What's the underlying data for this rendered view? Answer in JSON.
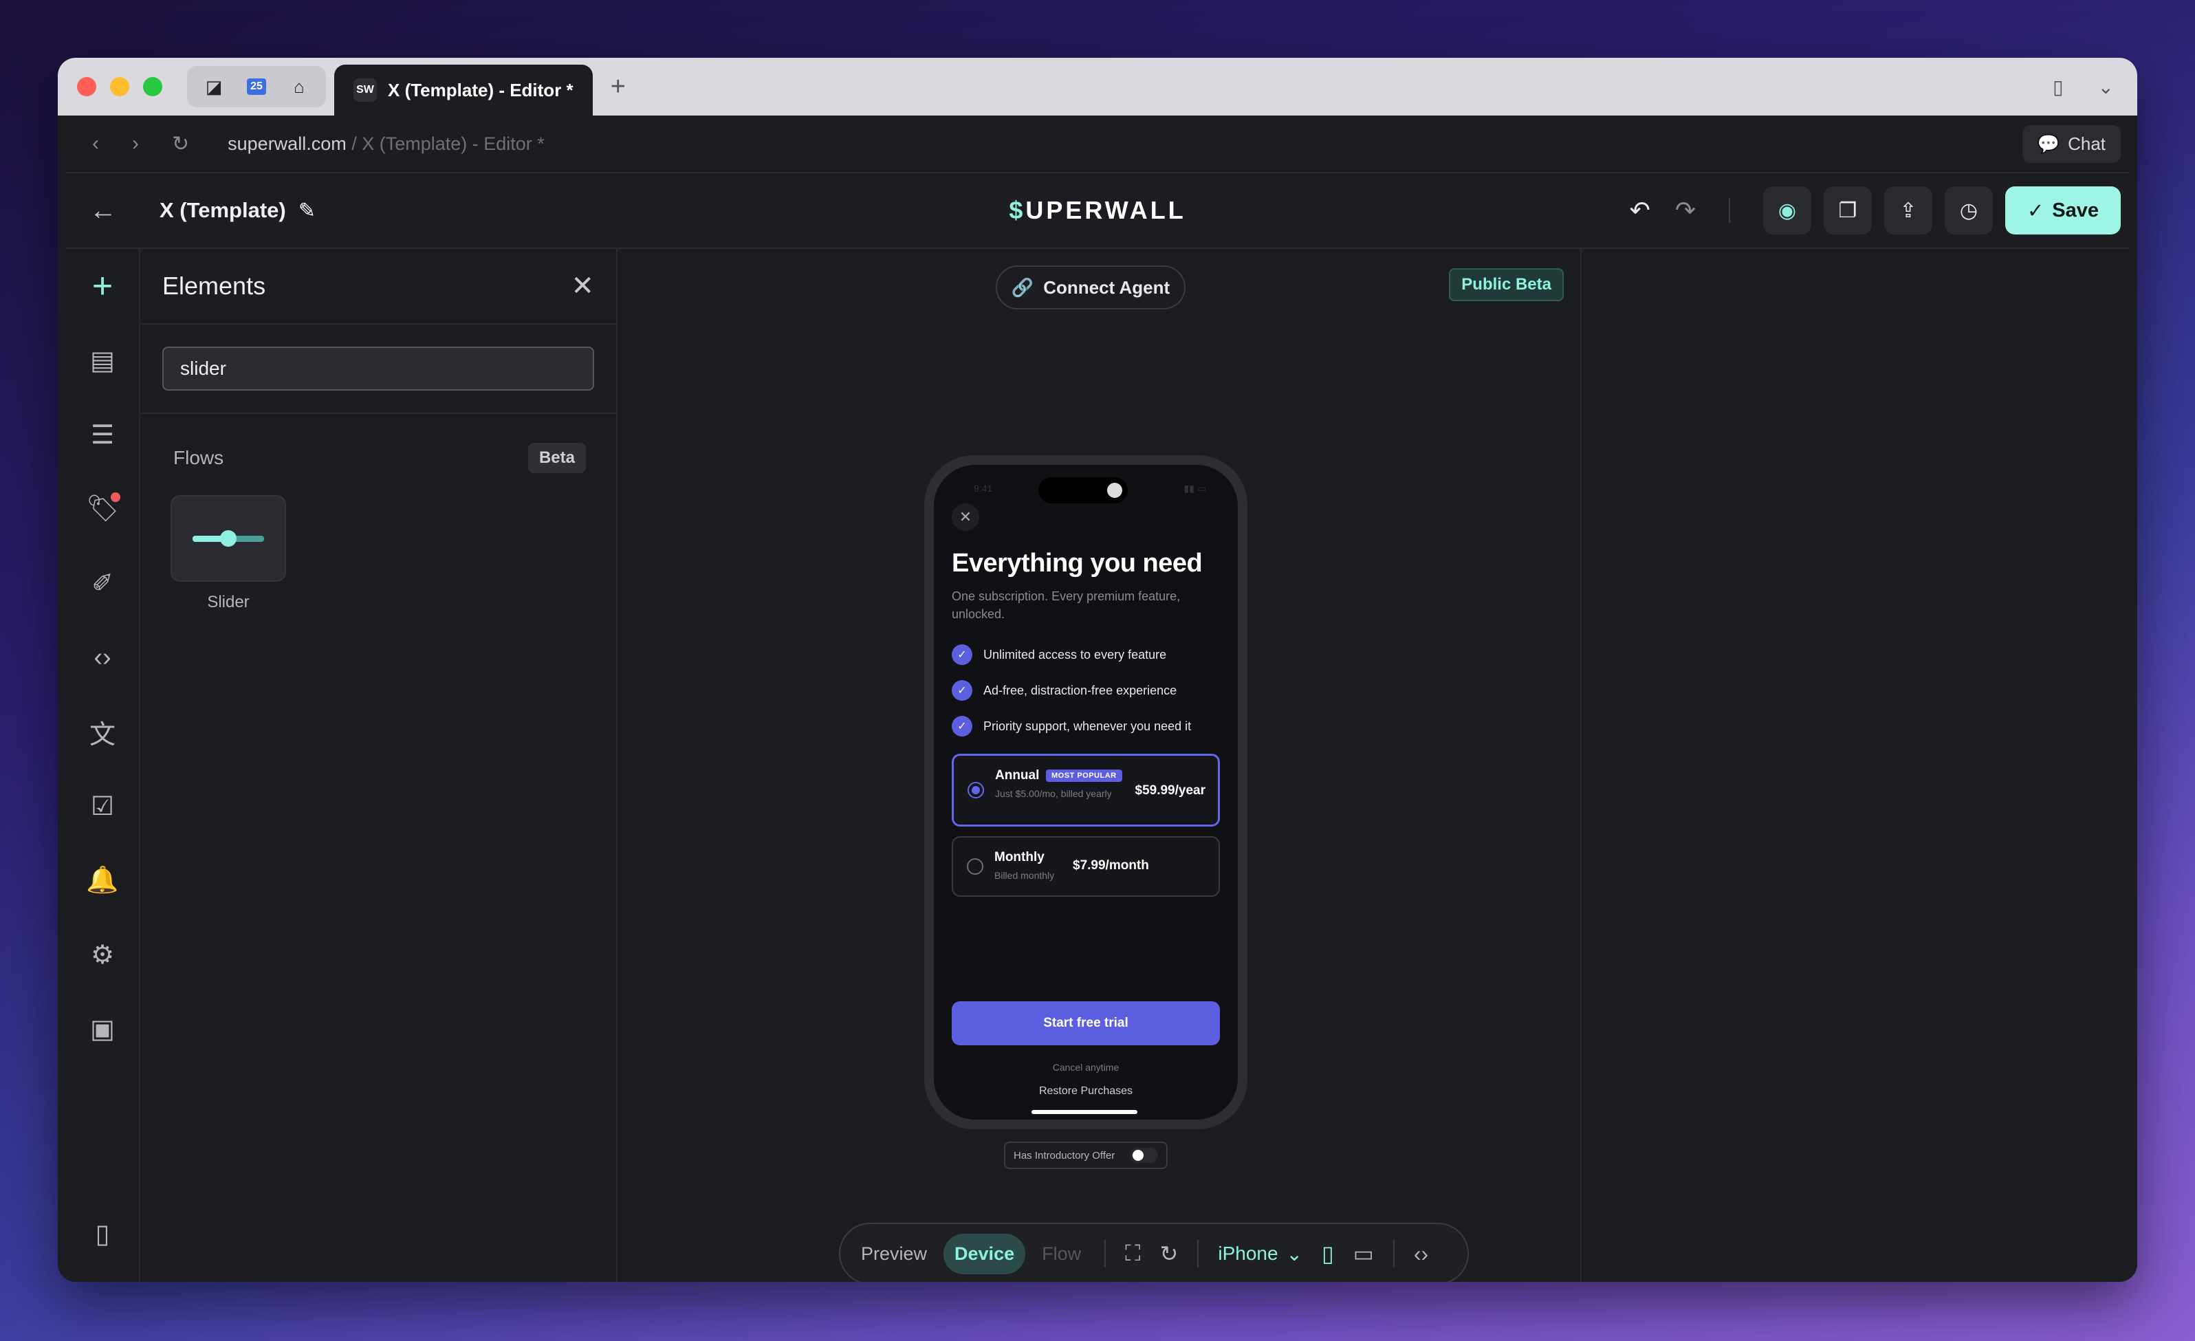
{
  "browser": {
    "active_tab_title": "X (Template) - Editor *",
    "tab_favicon": "SW",
    "pinned_tabs": [
      "app-icon",
      "calendar-icon",
      "home-icon"
    ],
    "pinned_calendar_text": "25",
    "url_domain": "superwall.com",
    "url_path": " / X (Template) - Editor *",
    "chat_label": "Chat"
  },
  "toolbar": {
    "doc_title": "X (Template)",
    "brand_accent": "$",
    "brand_rest": "UPERWALL",
    "save_label": "Save"
  },
  "rail": {
    "items": [
      "add-icon",
      "layout-icon",
      "variables-icon",
      "products-tag-icon",
      "theme-brush-icon",
      "code-icon",
      "localization-icon",
      "checklist-icon",
      "notifications-bell-icon",
      "settings-gear-icon",
      "terminal-icon"
    ],
    "has_notification_on": "products-tag-icon"
  },
  "elements_panel": {
    "title": "Elements",
    "search_value": "slider",
    "section_title": "Flows",
    "section_badge": "Beta",
    "tiles": [
      {
        "label": "Slider",
        "icon": "slider-icon"
      }
    ]
  },
  "canvas": {
    "connect_agent_label": "Connect Agent",
    "public_beta_label": "Public Beta",
    "intro_offer_label": "Has Introductory Offer",
    "intro_offer_on": false
  },
  "paywall": {
    "title": "Everything you need",
    "subtitle": "One subscription. Every premium feature, unlocked.",
    "features": [
      "Unlimited access to every feature",
      "Ad-free, distraction-free experience",
      "Priority support, whenever you need it"
    ],
    "plans": [
      {
        "name": "Annual",
        "badge": "MOST POPULAR",
        "detail": "Just $5.00/mo, billed yearly",
        "price": "$59.99/year",
        "selected": true
      },
      {
        "name": "Monthly",
        "detail": "Billed monthly",
        "price": "$7.99/month",
        "selected": false
      }
    ],
    "cta_label": "Start free trial",
    "cancel_note": "Cancel anytime",
    "restore_label": "Restore Purchases"
  },
  "bottom_bar": {
    "modes": [
      "Preview",
      "Device",
      "Flow"
    ],
    "active_mode": "Device",
    "device": "iPhone"
  },
  "colors": {
    "accent_teal": "#8ff0e0",
    "save_bg": "#9ef5e5",
    "paywall_primary": "#5b5fe0",
    "background": "#1c1d21"
  }
}
